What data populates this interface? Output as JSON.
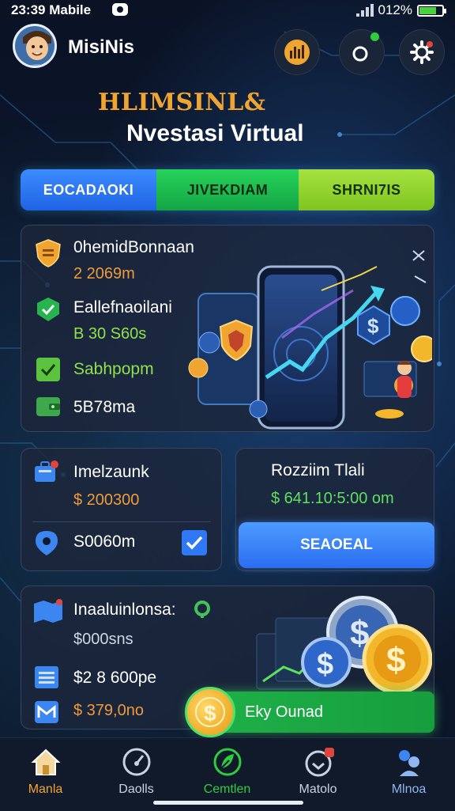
{
  "status_bar": {
    "time_carrier": "23:39 Mabile",
    "battery_text": "012%",
    "battery_level": 0.75
  },
  "header": {
    "user_name": "MisiNis",
    "notification_color": "#2ecc40"
  },
  "hero": {
    "title_line1": "HLIMSINL&",
    "title_line2": "Nvestasi Virtual"
  },
  "tabs": [
    {
      "label": "EOCADAOKI",
      "color": "#2f79f6"
    },
    {
      "label": "JIVEKDIAM",
      "color": "#1fbe50"
    },
    {
      "label": "SHRNI7IS",
      "color": "#93d532"
    }
  ],
  "portfolio_card": {
    "rows": [
      {
        "label": "0hemidBonnaan",
        "value": "2 2069m",
        "icon": "shield-icon",
        "value_color": "#f09a3a"
      },
      {
        "label": "Eallefnaoilani",
        "value": "B 30 S60s",
        "icon": "check-shield-icon",
        "value_color": "#8fe14d"
      },
      {
        "label": "Sabhpopm",
        "value": "",
        "icon": "check-box-icon",
        "value_color": "#8fe14d"
      },
      {
        "label": "5B78ma",
        "value": "",
        "icon": "wallet-icon",
        "value_color": "#ffffff"
      }
    ]
  },
  "balance_card": {
    "title": "Imelzaunk",
    "amount": "$ 200300",
    "sub_value": "S0060m"
  },
  "profit_card": {
    "title": "Rozziim Tlali",
    "amount": "$ 641.10:5:00 om",
    "button_label": "SEAOEAL"
  },
  "investment_card": {
    "title": "Inaaluinlonsa:",
    "value": "$000sns",
    "row2_value": "$2 8 600pe",
    "row3_value": "$ 379,0no",
    "earn_label": "Eky Ounad"
  },
  "bottom_nav": [
    {
      "label": "Manla",
      "icon": "home-icon",
      "active": true
    },
    {
      "label": "Daolls",
      "icon": "gauge-icon",
      "active": false
    },
    {
      "label": "Cemtlen",
      "icon": "leaf-icon",
      "active": false
    },
    {
      "label": "Matolo",
      "icon": "download-icon",
      "active": false
    },
    {
      "label": "Mlnoa",
      "icon": "profile-icon",
      "active": false
    }
  ]
}
